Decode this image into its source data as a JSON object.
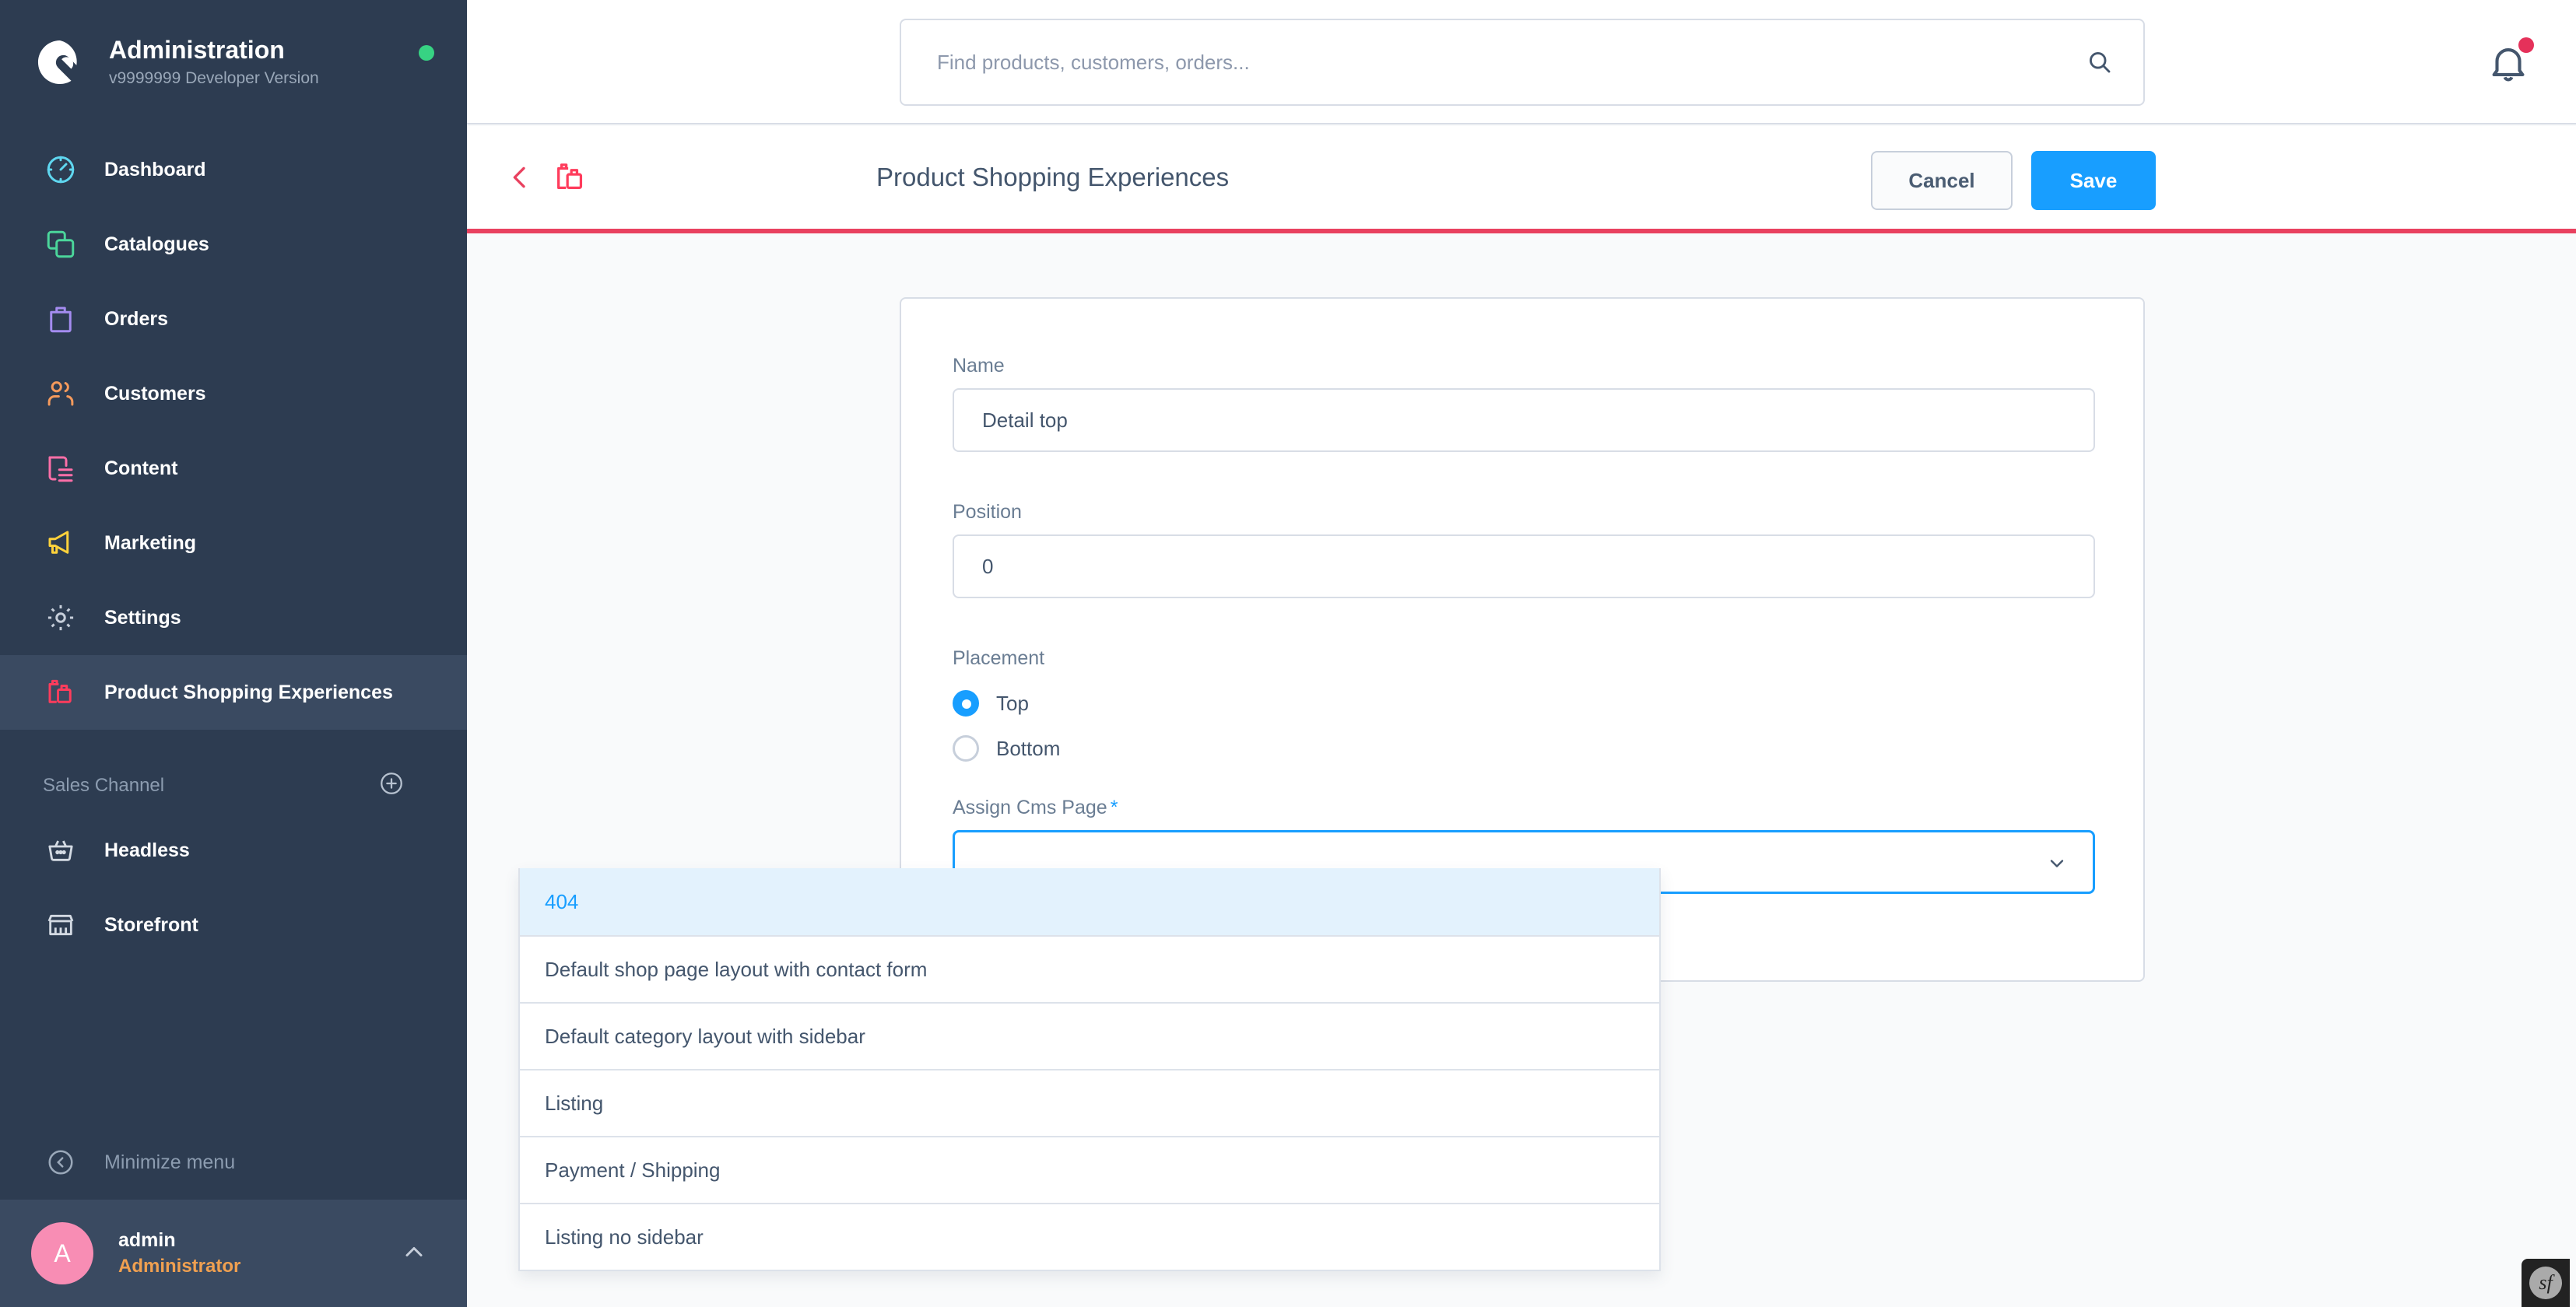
{
  "brand": {
    "title": "Administration",
    "version": "v9999999 Developer Version",
    "logo_icon": "shopware-logo-icon",
    "status_icon": "status-dot-online"
  },
  "sidebar": {
    "items": [
      {
        "label": "Dashboard",
        "icon": "dashboard-icon",
        "color": "#5FD7F0",
        "active": false
      },
      {
        "label": "Catalogues",
        "icon": "catalogues-icon",
        "color": "#4BD69B",
        "active": false
      },
      {
        "label": "Orders",
        "icon": "orders-icon",
        "color": "#A48CF0",
        "active": false
      },
      {
        "label": "Customers",
        "icon": "customers-icon",
        "color": "#F59A5C",
        "active": false
      },
      {
        "label": "Content",
        "icon": "content-icon",
        "color": "#FF6FA8",
        "active": false
      },
      {
        "label": "Marketing",
        "icon": "marketing-icon",
        "color": "#FFD23B",
        "active": false
      },
      {
        "label": "Settings",
        "icon": "settings-gear-icon",
        "color": "#C6CEDA",
        "active": false
      },
      {
        "label": "Product Shopping Experiences",
        "icon": "shopping-bags-icon",
        "color": "#FF3C5C",
        "active": true
      }
    ],
    "sales_channel": {
      "title": "Sales Channel",
      "add_icon": "plus-circle-icon",
      "channels": [
        {
          "label": "Headless",
          "icon": "basket-icon"
        },
        {
          "label": "Storefront",
          "icon": "storefront-icon"
        }
      ]
    },
    "minimize": {
      "label": "Minimize menu",
      "icon": "chevron-left-circle-icon"
    },
    "user": {
      "avatar_initial": "A",
      "name": "admin",
      "role": "Administrator",
      "expand_icon": "chevron-up-icon"
    }
  },
  "topbar": {
    "search_placeholder": "Find products, customers, orders...",
    "search_value": "",
    "search_icon": "search-icon",
    "bell_icon": "notification-bell-icon",
    "bell_badge": true
  },
  "page_header": {
    "back_icon": "chevron-left-icon",
    "module_icon": "shopping-bags-icon",
    "title": "Product Shopping Experiences",
    "cancel_label": "Cancel",
    "save_label": "Save"
  },
  "form": {
    "name": {
      "label": "Name",
      "value": "Detail top",
      "placeholder": ""
    },
    "position": {
      "label": "Position",
      "value": "0",
      "placeholder": ""
    },
    "placement": {
      "label": "Placement",
      "options": [
        {
          "label": "Top",
          "checked": true
        },
        {
          "label": "Bottom",
          "checked": false
        }
      ]
    },
    "cms_page": {
      "label": "Assign Cms Page",
      "required_marker": "*",
      "value": "",
      "chevron_icon": "chevron-down-icon",
      "options": [
        {
          "label": "404",
          "selected": true
        },
        {
          "label": "Default shop page layout with contact form",
          "selected": false
        },
        {
          "label": "Default category layout with sidebar",
          "selected": false
        },
        {
          "label": "Listing",
          "selected": false
        },
        {
          "label": "Payment / Shipping",
          "selected": false
        },
        {
          "label": "Listing no sidebar",
          "selected": false
        }
      ]
    }
  },
  "debug_toolbar": {
    "logo_icon": "symfony-logo-icon",
    "logo_text": "sf"
  },
  "colors": {
    "sidebar_bg": "#2D3C51",
    "sidebar_active": "#3A4A61",
    "accent_red": "#E9415F",
    "accent_blue": "#189EFF",
    "page_bg": "#F9FAFB",
    "text_dark": "#44566D"
  }
}
